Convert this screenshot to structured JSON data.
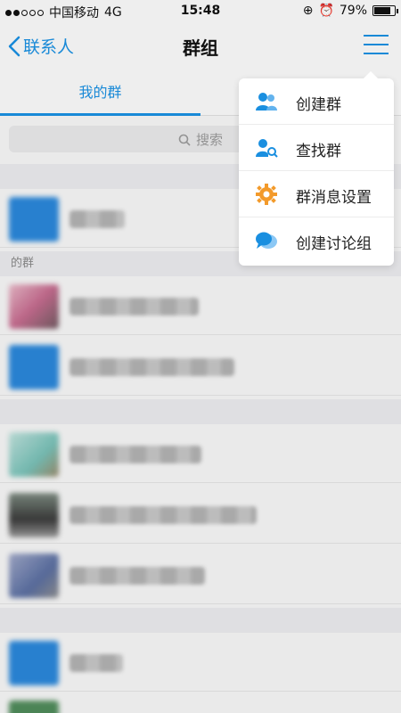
{
  "status": {
    "carrier": "中国移动",
    "network": "4G",
    "time": "15:48",
    "battery": "79%"
  },
  "nav": {
    "back_label": "联系人",
    "title": "群组"
  },
  "tabs": [
    {
      "label": "我的群",
      "active": true
    }
  ],
  "search": {
    "placeholder": "搜索"
  },
  "sections": [
    {
      "label": ""
    },
    {
      "label": "的群"
    },
    {
      "label": ""
    },
    {
      "label": ""
    }
  ],
  "menu": {
    "items": [
      {
        "label": "创建群",
        "icon": "create-group-icon"
      },
      {
        "label": "查找群",
        "icon": "find-group-icon"
      },
      {
        "label": "群消息设置",
        "icon": "group-settings-icon"
      },
      {
        "label": "创建讨论组",
        "icon": "create-discussion-icon"
      }
    ]
  },
  "colors": {
    "accent": "#1a8fe0",
    "settings_icon": "#f39a2b"
  }
}
